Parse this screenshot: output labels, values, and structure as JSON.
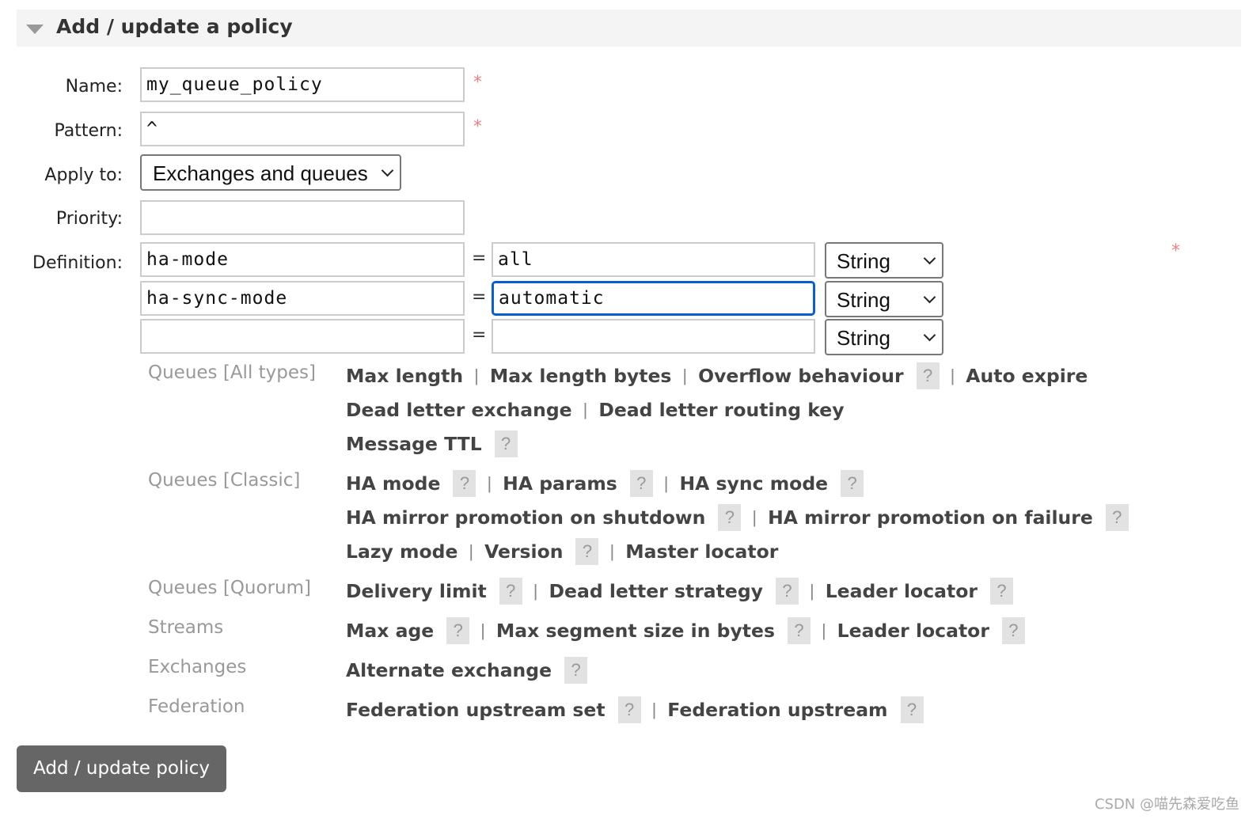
{
  "section": {
    "title": "Add / update a policy"
  },
  "form": {
    "name_label": "Name:",
    "name_value": "my_queue_policy",
    "pattern_label": "Pattern:",
    "pattern_value": "^",
    "apply_label": "Apply to:",
    "apply_value": "Exchanges and queues",
    "priority_label": "Priority:",
    "priority_value": "",
    "definition_label": "Definition:",
    "required_mark": "*",
    "equals": "=",
    "definitions": [
      {
        "key": "ha-mode",
        "value": "all",
        "type": "String"
      },
      {
        "key": "ha-sync-mode",
        "value": "automatic",
        "type": "String"
      },
      {
        "key": "",
        "value": "",
        "type": "String"
      }
    ]
  },
  "help": {
    "help_glyph": "?",
    "separator": "|",
    "groups": [
      {
        "category": "Queues [All types]",
        "lines": [
          [
            {
              "label": "Max length"
            },
            {
              "label": "Max length bytes"
            },
            {
              "label": "Overflow behaviour",
              "help": true
            },
            {
              "label": "Auto expire"
            }
          ],
          [
            {
              "label": "Dead letter exchange"
            },
            {
              "label": "Dead letter routing key"
            }
          ],
          [
            {
              "label": "Message TTL",
              "help": true
            }
          ]
        ]
      },
      {
        "category": "Queues [Classic]",
        "lines": [
          [
            {
              "label": "HA mode",
              "help": true
            },
            {
              "label": "HA params",
              "help": true
            },
            {
              "label": "HA sync mode",
              "help": true
            }
          ],
          [
            {
              "label": "HA mirror promotion on shutdown",
              "help": true
            },
            {
              "label": "HA mirror promotion on failure",
              "help": true
            }
          ],
          [
            {
              "label": "Lazy mode"
            },
            {
              "label": "Version",
              "help": true
            },
            {
              "label": "Master locator"
            }
          ]
        ]
      },
      {
        "category": "Queues [Quorum]",
        "lines": [
          [
            {
              "label": "Delivery limit",
              "help": true
            },
            {
              "label": "Dead letter strategy",
              "help": true
            },
            {
              "label": "Leader locator",
              "help": true
            }
          ]
        ]
      },
      {
        "category": "Streams",
        "lines": [
          [
            {
              "label": "Max age",
              "help": true
            },
            {
              "label": "Max segment size in bytes",
              "help": true
            },
            {
              "label": "Leader locator",
              "help": true
            }
          ]
        ]
      },
      {
        "category": "Exchanges",
        "lines": [
          [
            {
              "label": "Alternate exchange",
              "help": true
            }
          ]
        ]
      },
      {
        "category": "Federation",
        "lines": [
          [
            {
              "label": "Federation upstream set",
              "help": true
            },
            {
              "label": "Federation upstream",
              "help": true
            }
          ]
        ]
      }
    ]
  },
  "submit_label": "Add / update policy",
  "watermark": "CSDN @喵先森爱吃鱼",
  "colors": {
    "accent_focus": "#0a5fd0",
    "required": "#f08080",
    "button": "#666666"
  }
}
